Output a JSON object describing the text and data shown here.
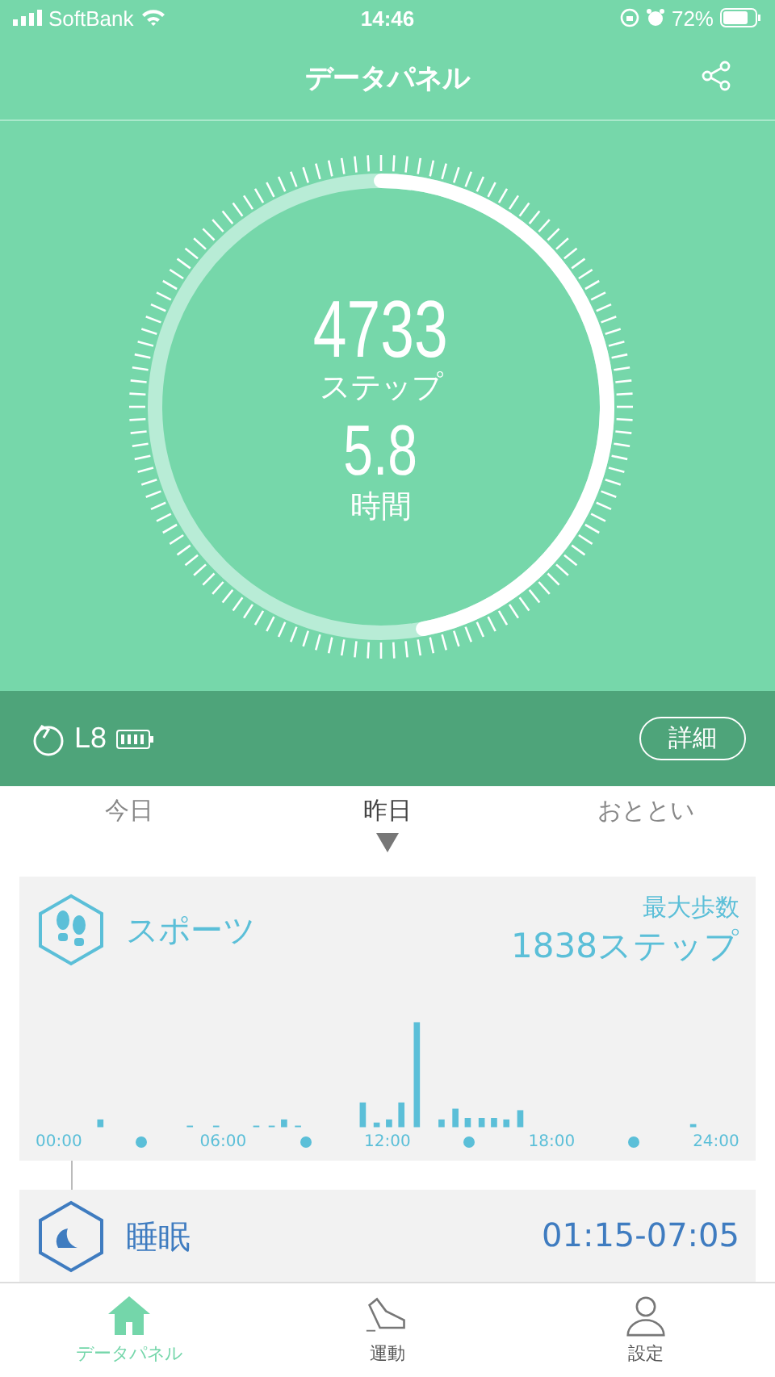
{
  "status_bar": {
    "carrier": "SoftBank",
    "time": "14:46",
    "battery": "72%"
  },
  "header": {
    "title": "データパネル"
  },
  "summary": {
    "steps": "4733",
    "steps_unit": "ステップ",
    "hours": "5.8",
    "hours_unit": "時間",
    "level": 0.47
  },
  "device": {
    "name": "L8",
    "button": "詳細"
  },
  "day_tabs": [
    {
      "label": "今日",
      "selected": false
    },
    {
      "label": "昨日",
      "selected": true
    },
    {
      "label": "おととい",
      "selected": false
    }
  ],
  "sports_card": {
    "title": "スポーツ",
    "max_label": "最大歩数",
    "max_value": "1838ステップ",
    "axis_labels": [
      "00:00",
      "06:00",
      "12:00",
      "18:00",
      "24:00"
    ]
  },
  "sleep_card": {
    "title": "睡眠",
    "time": "01:15-07:05"
  },
  "nav": [
    {
      "kind": "home",
      "label": "データパネル",
      "selected": true
    },
    {
      "kind": "shoe",
      "label": "運動",
      "selected": false
    },
    {
      "kind": "person",
      "label": "設定",
      "selected": false
    }
  ]
}
